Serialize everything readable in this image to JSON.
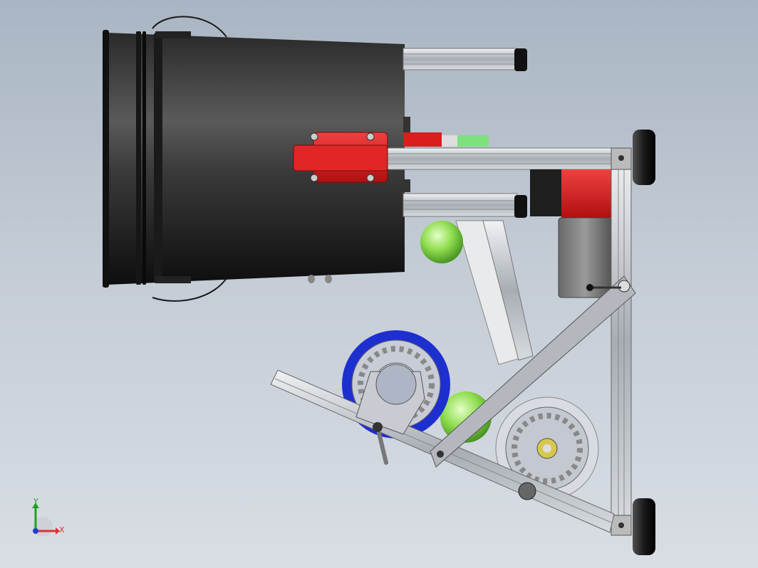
{
  "triad": {
    "x_label": "X",
    "y_label": "Y",
    "x_color": "#e03030",
    "y_color": "#20a020",
    "z_color": "#2040d0"
  },
  "model": {
    "view": "front",
    "parts": [
      "bucket",
      "bucket-handle",
      "aluminum-extrusion-rail",
      "red-mount-block",
      "motor",
      "gearbox",
      "wheel-blue",
      "wheel-white",
      "tennis-ball",
      "pivot-arm",
      "adjust-lever",
      "rubber-foot"
    ],
    "colors": {
      "bucket": "#1b1b1b",
      "extrusion": "#b8bcc2",
      "red_part": "#d81e1e",
      "wheel_tire_blue": "#1e2fd0",
      "wheel_tire_white": "#d8dbe2",
      "ball": "#8fd850",
      "foot": "#1a1a1a"
    }
  }
}
